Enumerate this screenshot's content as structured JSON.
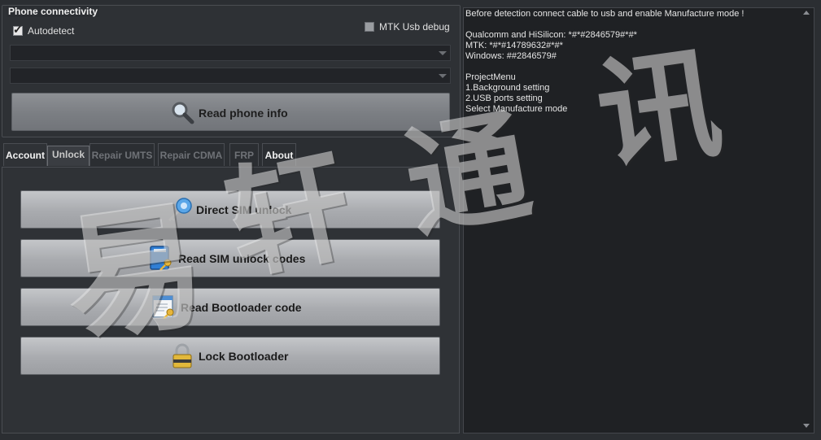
{
  "connectivity": {
    "title": "Phone connectivity",
    "autodetect_label": "Autodetect",
    "autodetect_checked": true,
    "mtk_debug_label": "MTK Usb debug",
    "mtk_debug_checked": false,
    "port_combo_value": "",
    "model_combo_value": "",
    "read_info_label": "Read phone info"
  },
  "tabs": [
    {
      "label": "Account"
    },
    {
      "label": "Unlock"
    },
    {
      "label": "Repair UMTS"
    },
    {
      "label": "Repair CDMA"
    },
    {
      "label": "FRP"
    },
    {
      "label": "About"
    }
  ],
  "unlock": {
    "direct_sim": "Direct SIM unlock",
    "read_sim_codes": "Read SIM unlock codes",
    "read_boot_code": "Read Bootloader code",
    "lock_boot": "Lock Bootloader"
  },
  "log": {
    "lines": "Before detection connect cable to usb and enable Manufacture mode !\n\nQualcomm and HiSilicon: *#*#2846579#*#*\nMTK: *#*#14789632#*#*\nWindows: ##2846579#\n\nProjectMenu\n1.Background setting\n2.USB ports setting\nSelect Manufacture mode"
  },
  "watermark": {
    "c1": "易",
    "c2": "轩",
    "c3": "通",
    "c4": "讯"
  },
  "icons": {
    "search": "magnifier-icon",
    "sim": "sim-key-icon",
    "book": "book-key-icon",
    "doc": "document-key-icon",
    "lock": "padlock-icon"
  }
}
